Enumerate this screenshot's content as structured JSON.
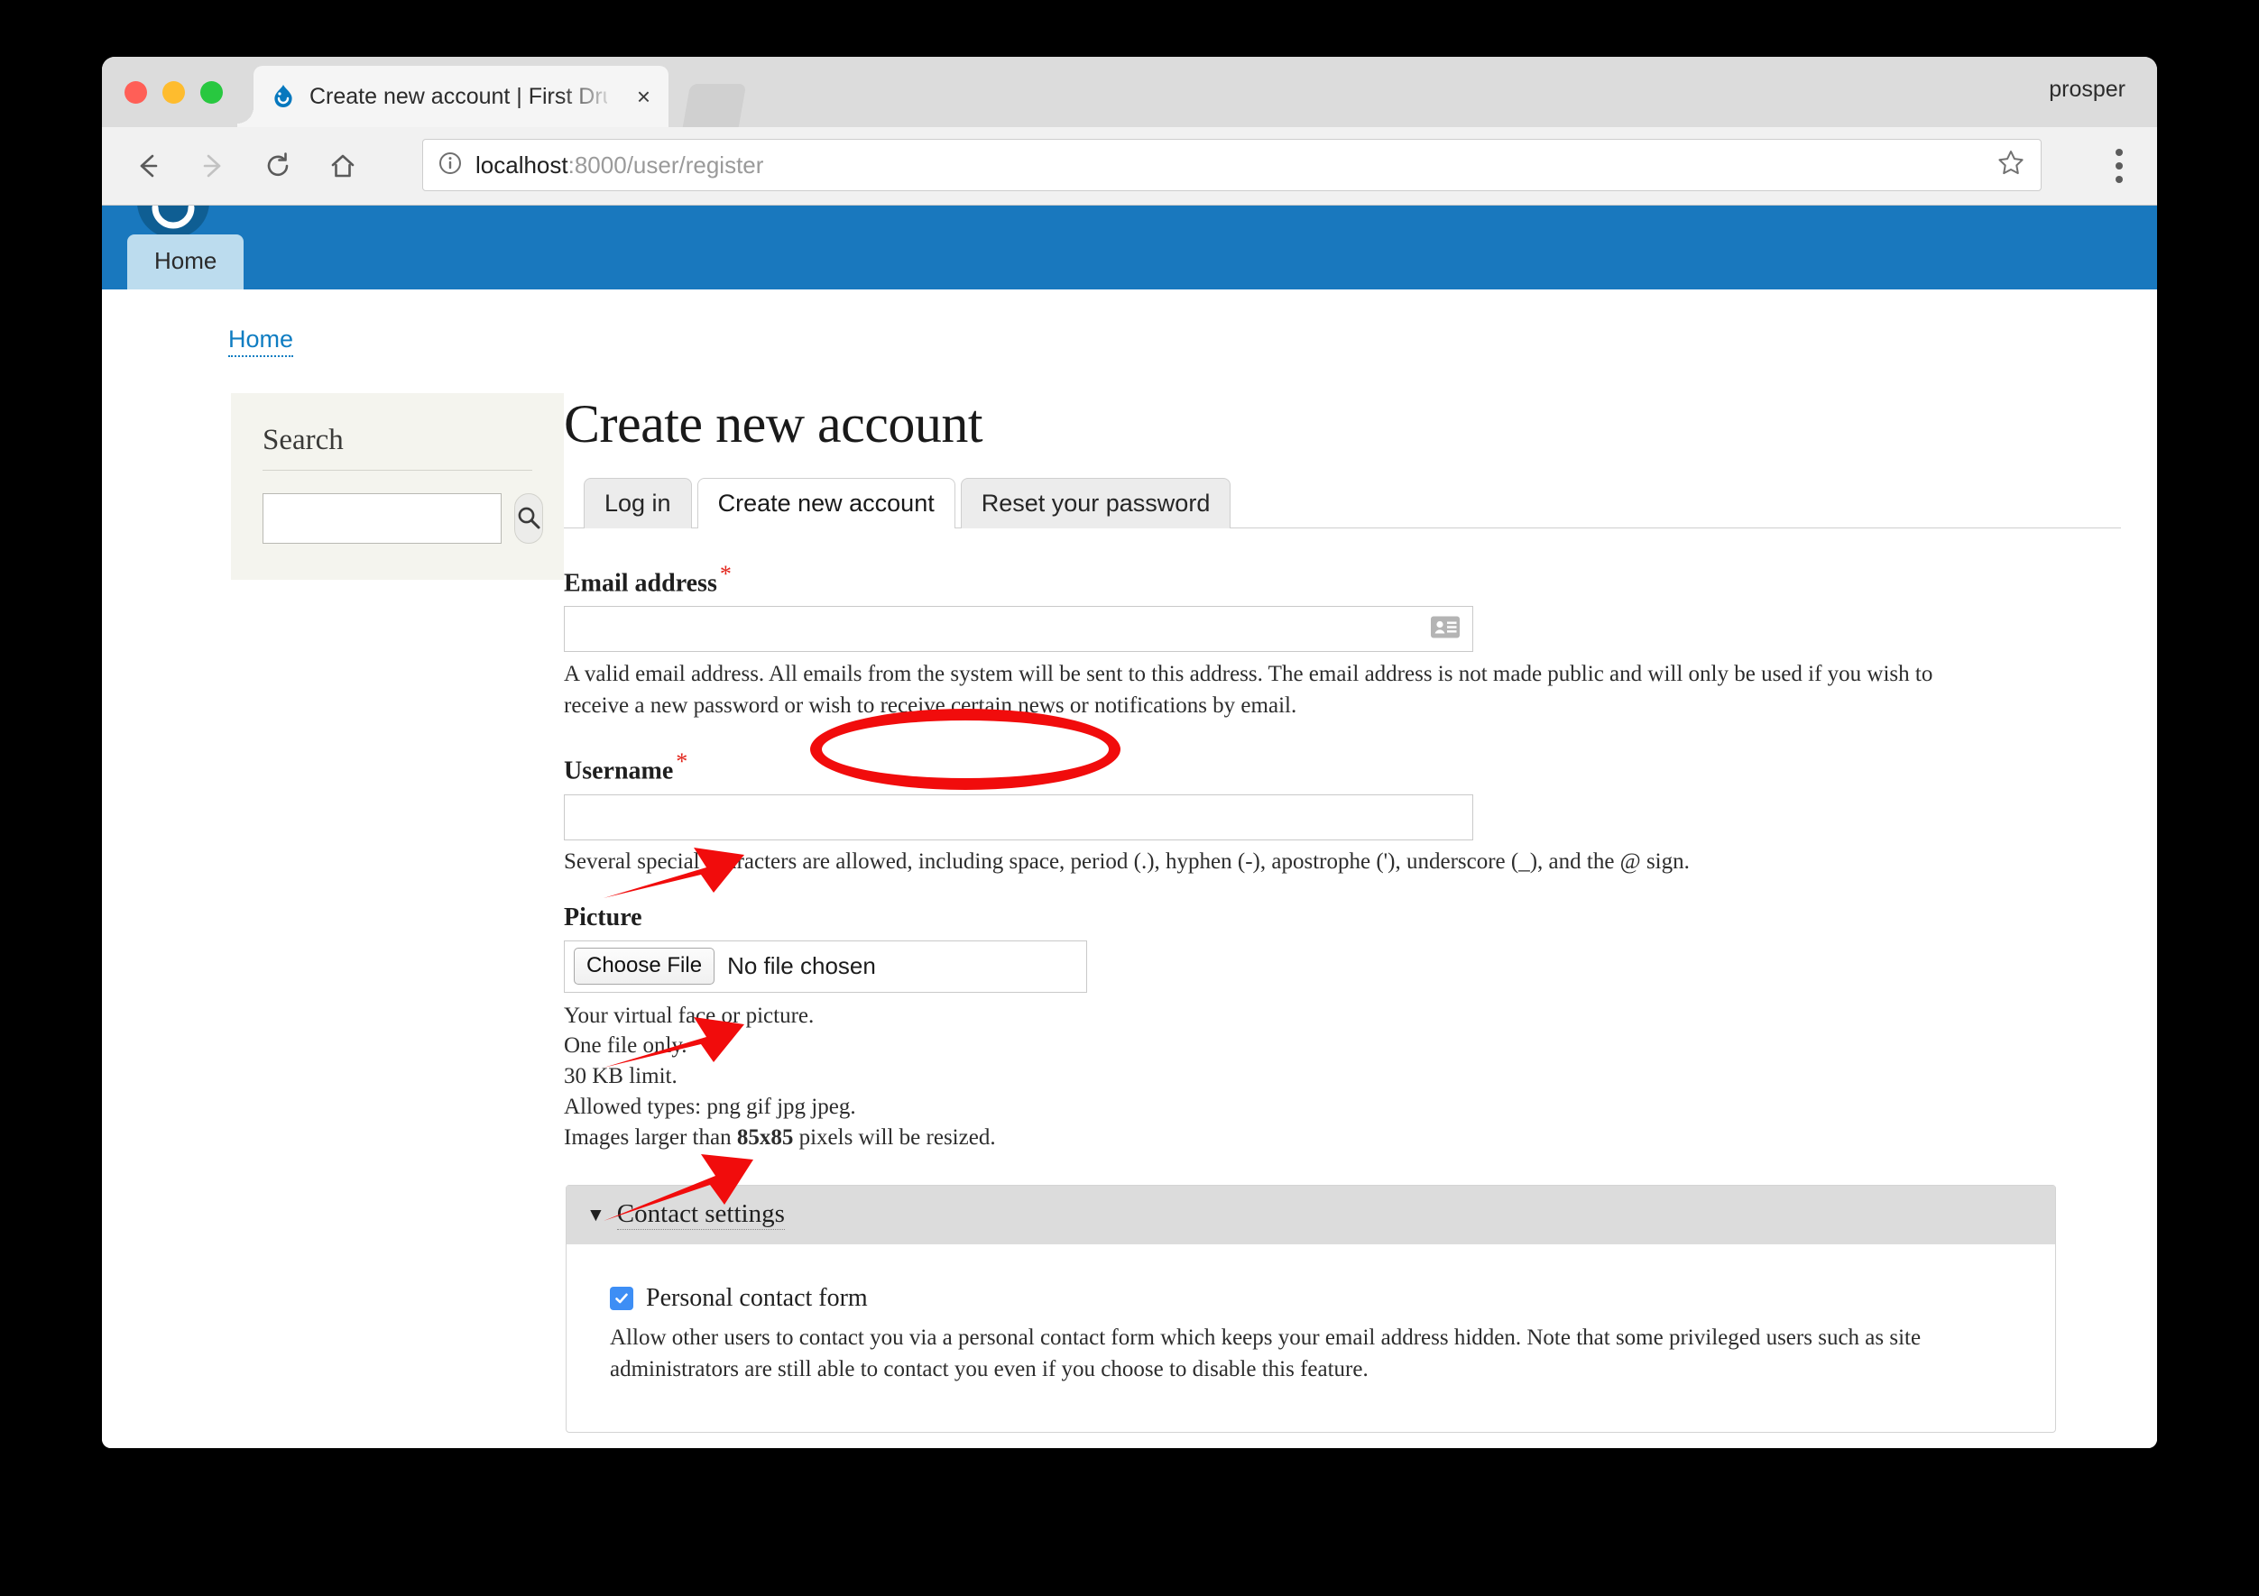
{
  "browser": {
    "tab_title": "Create new account | First Dru",
    "tab_close_label": "×",
    "profile_name": "prosper",
    "url_host": "localhost",
    "url_rest": ":8000/user/register",
    "icons": {
      "back": "back-arrow-icon",
      "forward": "forward-arrow-icon",
      "reload": "reload-icon",
      "home": "home-icon",
      "info": "info-circle-icon",
      "bookmark": "star-icon",
      "menu": "three-dots-menu-icon",
      "favicon": "drupal-favicon"
    }
  },
  "site": {
    "primary_menu": [
      {
        "label": "Home"
      }
    ],
    "breadcrumb": [
      {
        "label": "Home"
      }
    ],
    "header_color": "#1978be"
  },
  "sidebar": {
    "search_block": {
      "title": "Search",
      "input_value": "",
      "input_placeholder": "",
      "submit_icon": "magnifier-icon"
    }
  },
  "main": {
    "page_title": "Create new account",
    "local_tasks": [
      {
        "label": "Log in",
        "active": false
      },
      {
        "label": "Create new account",
        "active": true
      },
      {
        "label": "Reset your password",
        "active": false
      }
    ],
    "form": {
      "email": {
        "label": "Email address",
        "required_mark": "*",
        "value": "",
        "autofill_icon": "contact-card-icon",
        "description": "A valid email address. All emails from the system will be sent to this address. The email address is not made public and will only be used if you wish to receive a new password or wish to receive certain news or notifications by email."
      },
      "username": {
        "label": "Username",
        "required_mark": "*",
        "value": "",
        "description": "Several special characters are allowed, including space, period (.), hyphen (-), apostrophe ('), underscore (_), and the @ sign."
      },
      "picture": {
        "label": "Picture",
        "choose_file_label": "Choose File",
        "file_status": "No file chosen",
        "help_lines": [
          "Your virtual face or picture.",
          "One file only.",
          "30 KB limit.",
          "Allowed types: png gif jpg jpeg."
        ],
        "resize_prefix": "Images larger than ",
        "resize_dimensions": "85x85",
        "resize_suffix": " pixels will be resized."
      },
      "contact_settings": {
        "legend": "Contact settings",
        "caret": "▼",
        "checkbox_label": "Personal contact form",
        "checkbox_checked": true,
        "description": "Allow other users to contact you via a personal contact form which keeps your email address hidden. Note that some privileged users such as site administrators are still able to contact you even if you choose to disable this feature."
      }
    }
  },
  "annotations": {
    "highlight_color": "#f10c0c",
    "ellipse_target": "Create new account",
    "arrows": [
      {
        "points_to": "email-input"
      },
      {
        "points_to": "username-input"
      },
      {
        "points_to": "choose-file-button"
      }
    ]
  }
}
